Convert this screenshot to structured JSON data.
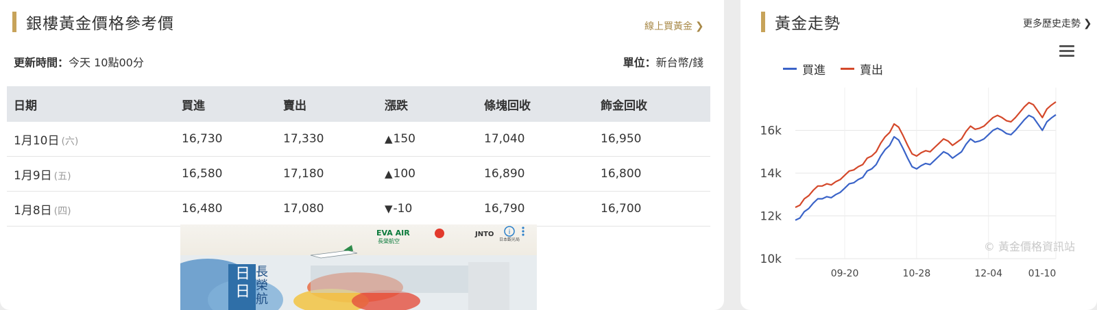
{
  "left": {
    "title": "銀樓黃金價格參考價",
    "buy_link": "線上買黃金",
    "update_label": "更新時間：",
    "update_value": "今天 10點00分",
    "unit_label": "單位：",
    "unit_value": "新台幣/錢",
    "columns": [
      "日期",
      "買進",
      "賣出",
      "漲跌",
      "條塊回收",
      "飾金回收"
    ],
    "rows": [
      {
        "date": "1月10日",
        "weekday": "(六)",
        "buy": "16,730",
        "sell": "17,330",
        "change": "150",
        "direction": "up",
        "bar": "17,040",
        "jewelry": "16,950"
      },
      {
        "date": "1月9日",
        "weekday": "(五)",
        "buy": "16,580",
        "sell": "17,180",
        "change": "100",
        "direction": "up",
        "bar": "16,890",
        "jewelry": "16,800"
      },
      {
        "date": "1月8日",
        "weekday": "(四)",
        "buy": "16,480",
        "sell": "17,080",
        "change": "-10",
        "direction": "down",
        "bar": "16,790",
        "jewelry": "16,700"
      }
    ],
    "ad": {
      "brand": "EVA AIR",
      "brand_sub": "長榮航空",
      "partner": "JNTO",
      "headline": "長榮航",
      "big_text": "日日"
    }
  },
  "right": {
    "title": "黃金走勢",
    "history_link": "更多歷史走勢",
    "menu_icon": "hamburger-menu-icon",
    "watermark": "© 黃金價格資訊站"
  },
  "colors": {
    "accent": "#c7a35a",
    "buy_line": "#3a63c8",
    "sell_line": "#d4482a",
    "up": "#d0141f",
    "down": "#1b8a2e"
  },
  "chart_data": {
    "type": "line",
    "title": "",
    "xlabel": "",
    "ylabel": "",
    "ylim": [
      10000,
      18000
    ],
    "yticks": [
      10000,
      12000,
      14000,
      16000
    ],
    "ytick_labels": [
      "10k",
      "12k",
      "14k",
      "16k"
    ],
    "x_ticks": [
      "09-20",
      "10-28",
      "12-04",
      "01-10"
    ],
    "legend": "top-left",
    "grid": true,
    "series": [
      {
        "name": "買進",
        "color": "#3a63c8",
        "values": [
          11800,
          11900,
          12200,
          12350,
          12600,
          12800,
          12800,
          12900,
          12850,
          13000,
          13100,
          13300,
          13500,
          13550,
          13700,
          13800,
          14100,
          14200,
          14400,
          14800,
          15100,
          15300,
          15700,
          15550,
          15150,
          14700,
          14300,
          14200,
          14350,
          14450,
          14400,
          14600,
          14800,
          15000,
          14900,
          14700,
          14850,
          15000,
          15350,
          15600,
          15450,
          15500,
          15600,
          15800,
          16000,
          16100,
          16000,
          15850,
          15800,
          16000,
          16250,
          16500,
          16700,
          16600,
          16300,
          16000,
          16400,
          16580,
          16730
        ]
      },
      {
        "name": "賣出",
        "color": "#d4482a",
        "values": [
          12400,
          12500,
          12800,
          12950,
          13200,
          13400,
          13400,
          13500,
          13450,
          13600,
          13700,
          13900,
          14100,
          14150,
          14300,
          14400,
          14700,
          14800,
          15000,
          15400,
          15700,
          15900,
          16300,
          16150,
          15750,
          15300,
          14900,
          14800,
          14950,
          15050,
          15000,
          15200,
          15400,
          15600,
          15500,
          15300,
          15450,
          15600,
          15950,
          16200,
          16050,
          16100,
          16200,
          16400,
          16600,
          16700,
          16600,
          16450,
          16400,
          16600,
          16850,
          17100,
          17300,
          17200,
          16900,
          16600,
          17000,
          17180,
          17330
        ]
      }
    ]
  }
}
